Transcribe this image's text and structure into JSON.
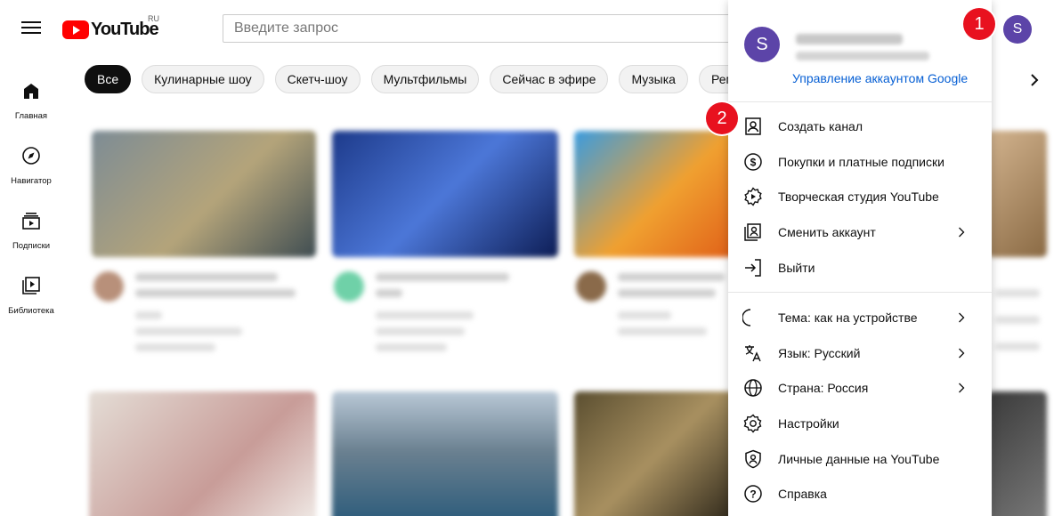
{
  "header": {
    "logo_text": "YouTube",
    "logo_region": "RU",
    "search_placeholder": "Введите запрос",
    "avatar_letter": "S"
  },
  "sidebar": {
    "items": [
      {
        "label": "Главная",
        "icon": "home-icon"
      },
      {
        "label": "Навигатор",
        "icon": "compass-icon"
      },
      {
        "label": "Подписки",
        "icon": "subscriptions-icon"
      },
      {
        "label": "Библиотека",
        "icon": "library-icon"
      }
    ]
  },
  "chips": [
    "Все",
    "Кулинарные шоу",
    "Скетч-шоу",
    "Мультфильмы",
    "Сейчас в эфире",
    "Музыка",
    "Рем"
  ],
  "menu": {
    "avatar_letter": "S",
    "manage_account": "Управление аккаунтом Google",
    "items": [
      {
        "label": "Создать канал",
        "icon": "create-channel-icon"
      },
      {
        "label": "Покупки и платные подписки",
        "icon": "dollar-icon"
      },
      {
        "label": "Творческая студия YouTube",
        "icon": "studio-icon"
      },
      {
        "label": "Сменить аккаунт",
        "icon": "switch-account-icon",
        "has_submenu": true
      },
      {
        "label": "Выйти",
        "icon": "sign-out-icon"
      },
      {
        "label": "Тема: как на устройстве",
        "icon": "moon-icon",
        "has_submenu": true
      },
      {
        "label": "Язык: Русский",
        "icon": "translate-icon",
        "has_submenu": true
      },
      {
        "label": "Страна: Россия",
        "icon": "globe-icon",
        "has_submenu": true
      },
      {
        "label": "Настройки",
        "icon": "gear-icon"
      },
      {
        "label": "Личные данные на YouTube",
        "icon": "shield-person-icon"
      },
      {
        "label": "Справка",
        "icon": "help-icon"
      }
    ]
  },
  "badges": [
    "1",
    "2"
  ],
  "colors": {
    "brand_red": "#ff0000",
    "avatar": "#5c44a8",
    "link": "#065fd4",
    "badge": "#e8111f"
  }
}
